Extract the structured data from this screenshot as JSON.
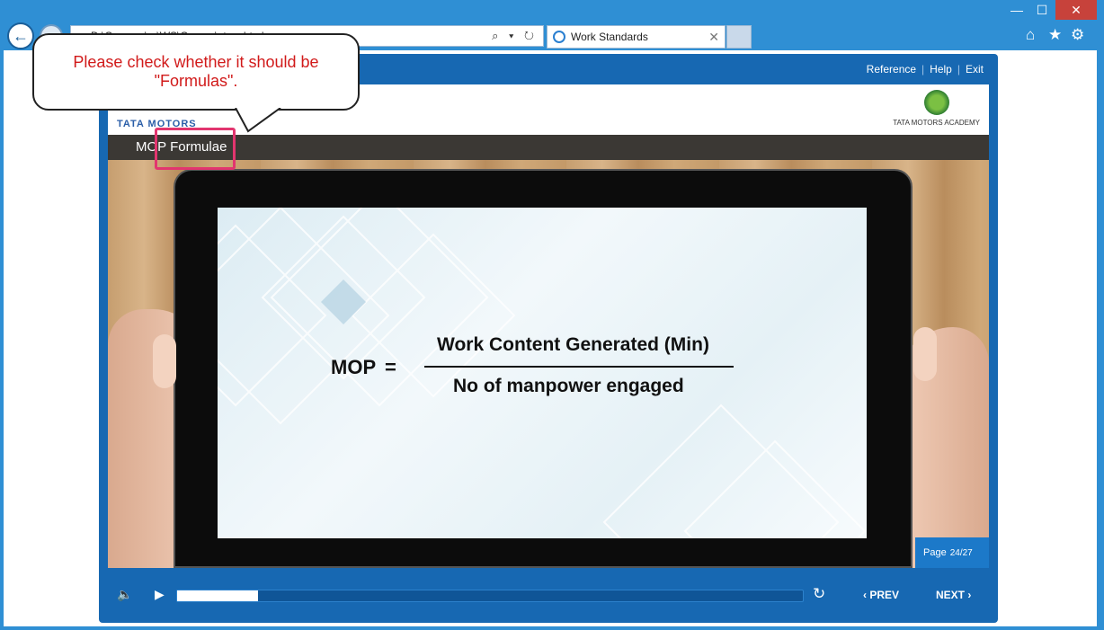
{
  "browser": {
    "address_text": "D:\\Courses\\...\\WS\\Course\\story.html",
    "tab_label": "Work Standards",
    "tab_close": "✕",
    "win_min": "—",
    "win_max": "☐",
    "win_close": "✕",
    "icons": [
      "home-icon",
      "star-icon",
      "gear-icon"
    ]
  },
  "player": {
    "links": [
      "Reference",
      "Help",
      "Exit"
    ],
    "brand": "TATA MOTORS",
    "academy": "TATA MOTORS ACADEMY",
    "slide_title": "MOP Formulae",
    "page_label": "Page",
    "page_number": "24/27",
    "prev_label": "PREV",
    "next_label": "NEXT",
    "progress": 0.13
  },
  "slide": {
    "lhs": "MOP",
    "equals": "=",
    "numerator": "Work Content Generated (Min)",
    "denominator": "No of manpower engaged"
  },
  "annotation": {
    "comment": "Please check whether it should be \"Formulas\"."
  }
}
